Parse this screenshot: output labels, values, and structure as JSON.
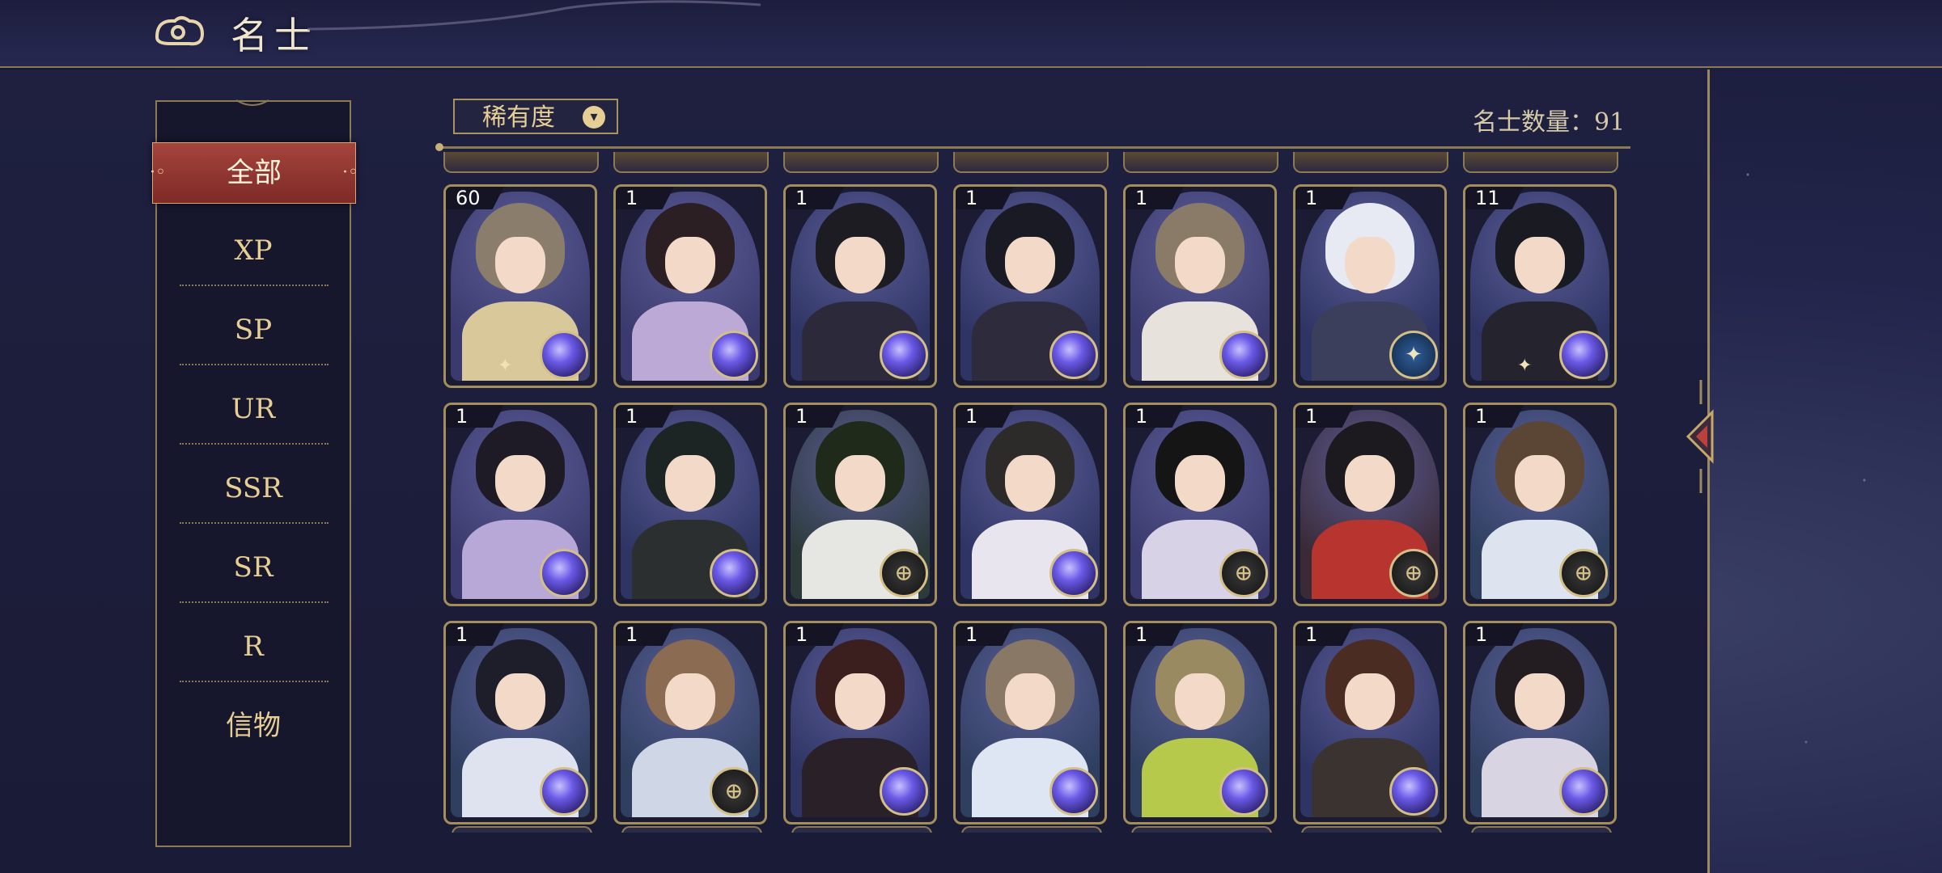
{
  "header": {
    "title": "名士"
  },
  "filter": {
    "label": "稀有度"
  },
  "count": {
    "label": "名士数量：",
    "value": "91"
  },
  "sidebar": {
    "items": [
      {
        "label": "全部",
        "active": true
      },
      {
        "label": "XP"
      },
      {
        "label": "SP"
      },
      {
        "label": "UR"
      },
      {
        "label": "SSR"
      },
      {
        "label": "SR"
      },
      {
        "label": "R"
      },
      {
        "label": "信物"
      }
    ]
  },
  "cards": [
    {
      "level": "60",
      "badge": "orb-icon",
      "hair": "#8a7d6b",
      "body": "#d8c89a",
      "bg": "#3b3a6e",
      "star": true
    },
    {
      "level": "1",
      "badge": "orb-icon",
      "hair": "#2b1f24",
      "body": "#bda9d6",
      "bg": "#3b3a6e"
    },
    {
      "level": "1",
      "badge": "orb-icon",
      "hair": "#1c1c22",
      "body": "#2c2a3a",
      "bg": "#2e3463"
    },
    {
      "level": "1",
      "badge": "orb-icon",
      "hair": "#1a1a24",
      "body": "#2d2b3c",
      "bg": "#2e3463"
    },
    {
      "level": "1",
      "badge": "orb-icon",
      "hair": "#8a7a68",
      "body": "#e8e2dc",
      "bg": "#3b3a6e"
    },
    {
      "level": "1",
      "badge": "seal-icon",
      "hair": "#e7e9f3",
      "body": "#3b3f5c",
      "bg": "#2e3463"
    },
    {
      "level": "11",
      "badge": "orb-icon",
      "hair": "#1a1a22",
      "body": "#25242e",
      "bg": "#2e3463",
      "star": true
    },
    {
      "level": "1",
      "badge": "orb-icon",
      "hair": "#1e1b26",
      "body": "#b8a8d8",
      "bg": "#3b3a6e"
    },
    {
      "level": "1",
      "badge": "orb-icon",
      "hair": "#1c2424",
      "body": "#2b2f2f",
      "bg": "#2e3463"
    },
    {
      "level": "1",
      "badge": "compass-icon",
      "hair": "#1f2a1a",
      "body": "#e6e7e2",
      "bg": "#2c3a3a"
    },
    {
      "level": "1",
      "badge": "orb-icon",
      "hair": "#2d2a2a",
      "body": "#e9e5ee",
      "bg": "#2e3463"
    },
    {
      "level": "1",
      "badge": "compass-icon",
      "hair": "#151515",
      "body": "#d8d2e6",
      "bg": "#3b3a6e"
    },
    {
      "level": "1",
      "badge": "compass-icon",
      "hair": "#1c1a1f",
      "body": "#b8342e",
      "bg": "#3a2a36"
    },
    {
      "level": "1",
      "badge": "compass-icon",
      "hair": "#5b4636",
      "body": "#dde4ef",
      "bg": "#2e3f5f"
    },
    {
      "level": "1",
      "badge": "orb-icon",
      "hair": "#1e1e2b",
      "body": "#dfe3ef",
      "bg": "#2e3f5f"
    },
    {
      "level": "1",
      "badge": "compass-icon",
      "hair": "#8b6b52",
      "body": "#cfd6e6",
      "bg": "#2e3f5f"
    },
    {
      "level": "1",
      "badge": "orb-icon",
      "hair": "#3a1f1e",
      "body": "#2a2028",
      "bg": "#2e3463"
    },
    {
      "level": "1",
      "badge": "orb-icon",
      "hair": "#8a7866",
      "body": "#dde6f2",
      "bg": "#2e3f5f"
    },
    {
      "level": "1",
      "badge": "orb-icon",
      "hair": "#9a8a62",
      "body": "#b7c94a",
      "bg": "#2e3f5f"
    },
    {
      "level": "1",
      "badge": "orb-icon",
      "hair": "#4a2c22",
      "body": "#3a3330",
      "bg": "#2e3463"
    },
    {
      "level": "1",
      "badge": "orb-icon",
      "hair": "#231d22",
      "body": "#d8d4e2",
      "bg": "#2e3f5f"
    }
  ]
}
